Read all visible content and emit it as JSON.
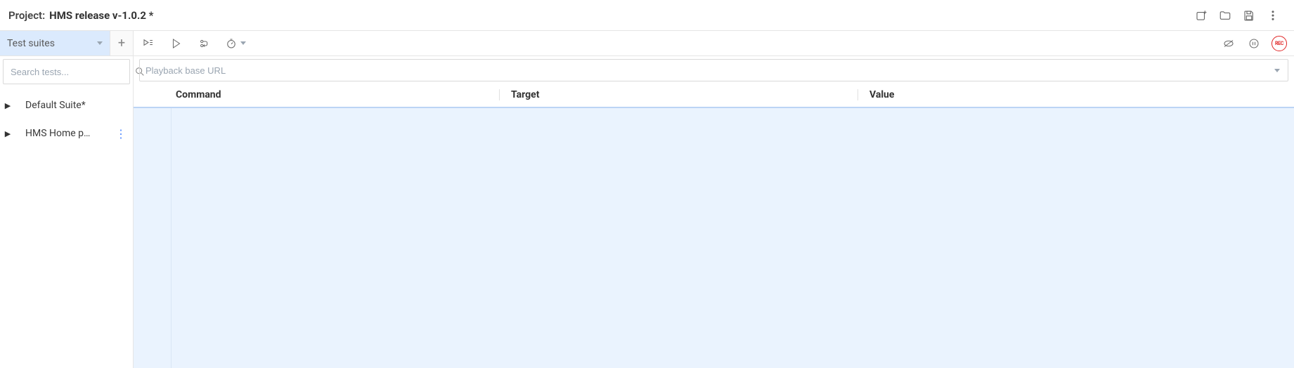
{
  "header": {
    "project_label": "Project:",
    "project_name": "HMS release v-1.0.2 *"
  },
  "sidebar": {
    "suites_label": "Test suites",
    "search_placeholder": "Search tests...",
    "items": [
      {
        "name": "Default Suite*"
      },
      {
        "name": "HMS Home p…"
      }
    ]
  },
  "toolbar": {
    "rec_label": "REC"
  },
  "url_bar": {
    "placeholder": "Playback base URL"
  },
  "table": {
    "command_header": "Command",
    "target_header": "Target",
    "value_header": "Value"
  }
}
